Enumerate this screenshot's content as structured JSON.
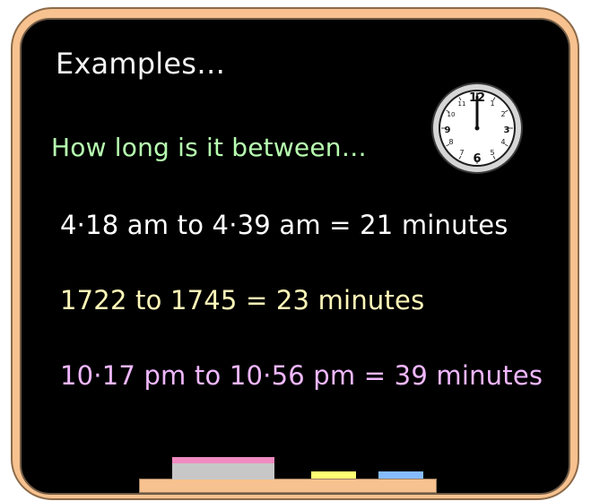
{
  "board": {
    "title": "Examples…",
    "question": "How long is it between…",
    "lines": [
      "4·18 am to 4·39 am = 21 minutes",
      "1722 to 1745 = 23 minutes",
      "10·17 pm to 10·56 pm = 39 minutes"
    ]
  },
  "clock": {
    "numbers": [
      "12",
      "1",
      "2",
      "3",
      "4",
      "5",
      "6",
      "7",
      "8",
      "9",
      "10",
      "11"
    ],
    "time": "12:00"
  },
  "colors": {
    "frame": "#f7c28f",
    "board": "#000000",
    "question": "#b7ffb0",
    "line1": "#ffffff",
    "line2": "#fff8b8",
    "line3": "#f0b7ff",
    "eraser_top": "#f08ac1",
    "chalk_yellow": "#ffff73",
    "chalk_blue": "#86bcff"
  }
}
